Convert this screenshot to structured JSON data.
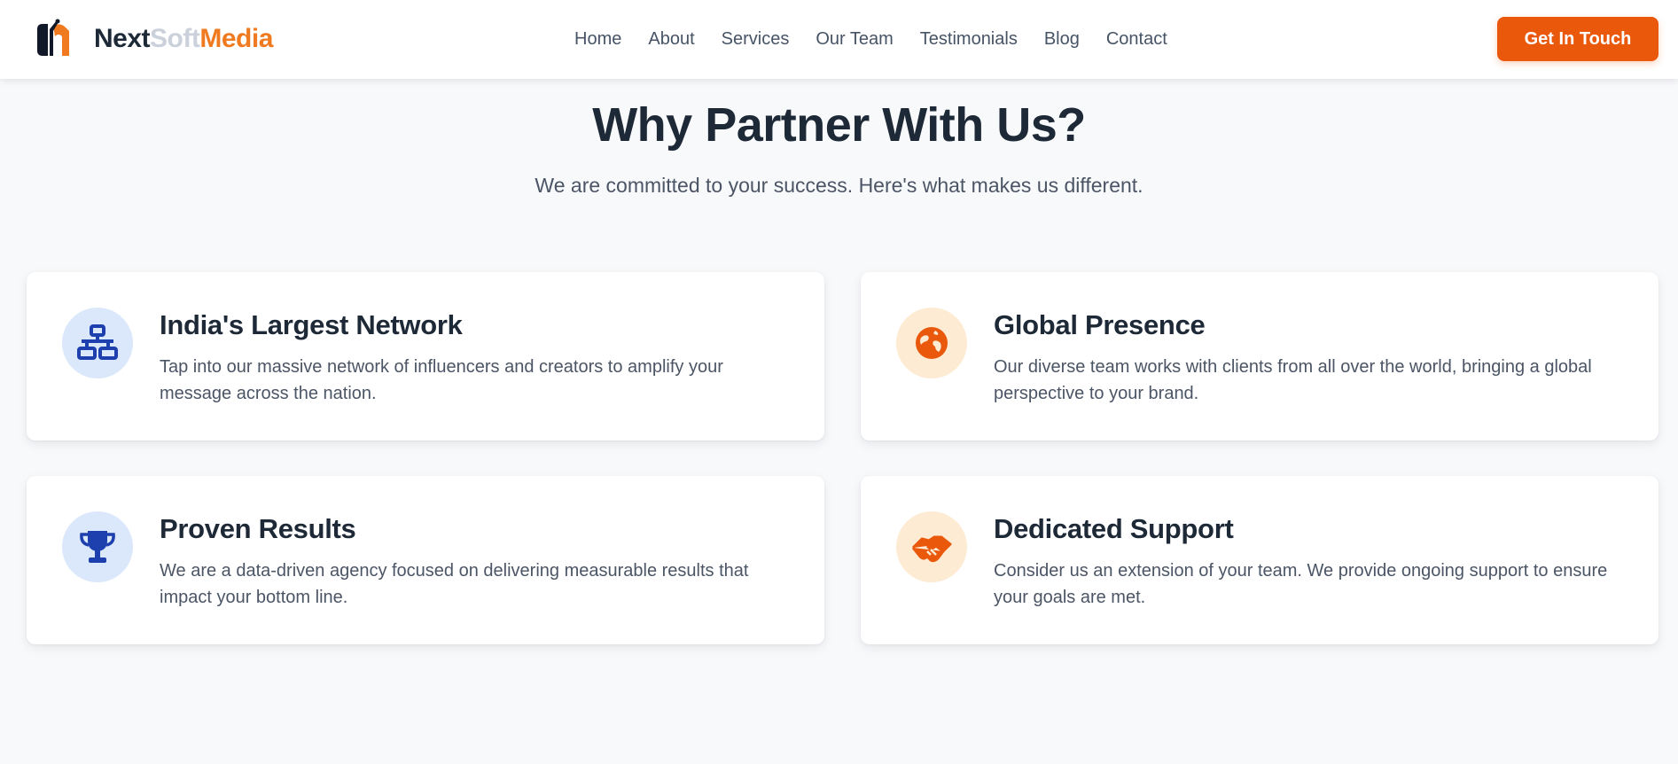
{
  "brand": {
    "name_part1": "Next",
    "name_part2": "Soft",
    "name_part3": "Media",
    "logo_icon": "brand-logo-mark",
    "colors": {
      "dark": "#1e2937",
      "light": "#cbd1da",
      "accent": "#f07a1f"
    }
  },
  "nav": {
    "items": [
      {
        "label": "Home"
      },
      {
        "label": "About"
      },
      {
        "label": "Services"
      },
      {
        "label": "Our Team"
      },
      {
        "label": "Testimonials"
      },
      {
        "label": "Blog"
      },
      {
        "label": "Contact"
      }
    ],
    "cta_label": "Get In Touch",
    "cta_color": "#ea580c"
  },
  "section": {
    "title": "Why Partner With Us?",
    "subtitle": "We are committed to your success. Here's what makes us different."
  },
  "features": [
    {
      "title": "India's Largest Network",
      "text": "Tap into our massive network of influencers and creators to amplify your message across the nation.",
      "icon": "network-icon",
      "icon_color": "#1e40af",
      "icon_bg": "#dbe8fb"
    },
    {
      "title": "Global Presence",
      "text": "Our diverse team works with clients from all over the world, bringing a global perspective to your brand.",
      "icon": "globe-icon",
      "icon_color": "#ea580c",
      "icon_bg": "#fdebd3"
    },
    {
      "title": "Proven Results",
      "text": "We are a data-driven agency focused on delivering measurable results that impact your bottom line.",
      "icon": "trophy-icon",
      "icon_color": "#1e40af",
      "icon_bg": "#dbe8fb"
    },
    {
      "title": "Dedicated Support",
      "text": "Consider us an extension of your team. We provide ongoing support to ensure your goals are met.",
      "icon": "handshake-icon",
      "icon_color": "#ea580c",
      "icon_bg": "#fdebd3"
    }
  ]
}
